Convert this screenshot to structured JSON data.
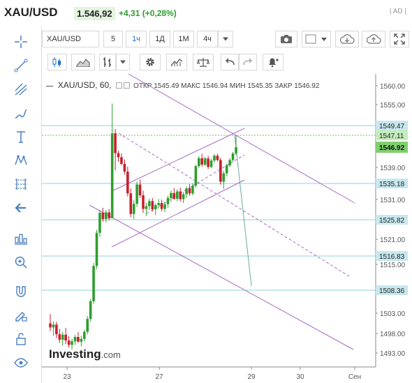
{
  "header": {
    "symbol": "XAU/USD",
    "price": "1.546,92",
    "change": "+4,31 (+0,28%)",
    "ad_label": "| AD |"
  },
  "toolbar": {
    "symbol_field": "XAU/USD",
    "intervals": [
      "5",
      "1ч",
      "1Д",
      "1М",
      "4ч"
    ],
    "active_interval": "1ч"
  },
  "chart_legend": {
    "name": "XAU/USD, 60,",
    "open_label": "ОТКР",
    "open": "1545.49",
    "high_label": "МАКС",
    "high": "1546.94",
    "low_label": "МИН",
    "low": "1545.35",
    "close_label": "ЗАКР",
    "close": "1546.92"
  },
  "logo": {
    "main": "Investing",
    "suffix": ".com"
  },
  "colors": {
    "up": "#2e9e2e",
    "down": "#c8202a",
    "channel": "#a86ac4",
    "hline": "#8fd0dc",
    "hline_label_bg": "#c6e8ee",
    "price_label_bg": "#7fcf6d",
    "accent": "#1c6cd2"
  },
  "chart_data": {
    "type": "candlestick",
    "y_ticks": [
      1560.0,
      1555.0,
      1539.0,
      1531.0,
      1521.0,
      1515.0,
      1503.0,
      1498.0,
      1493.0
    ],
    "y_tick_labels": [
      "1560.00",
      "1555.00",
      "1539.00",
      "1531.00",
      "1521.00",
      "1515.00",
      "1503.00",
      "1498.00",
      "1493.00"
    ],
    "x_ticks": [
      "23",
      "27",
      "29",
      "30",
      "Сен"
    ],
    "hlines": [
      {
        "value": 1549.47,
        "label": "1549.47"
      },
      {
        "value": 1547.11,
        "label": "1547.11"
      },
      {
        "value": 1535.18,
        "label": "1535.18"
      },
      {
        "value": 1525.82,
        "label": "1525.82"
      },
      {
        "value": 1516.83,
        "label": "1516.83"
      },
      {
        "value": 1508.36,
        "label": "1508.36"
      }
    ],
    "current_price": {
      "value": 1546.92,
      "label": "1546.92"
    },
    "ylim": [
      1491,
      1562
    ],
    "candles": [
      [
        1500.5,
        1502.8,
        1498.6,
        1499.5
      ],
      [
        1499.5,
        1501.0,
        1497.4,
        1500.2
      ],
      [
        1500.2,
        1500.9,
        1496.8,
        1497.8
      ],
      [
        1497.8,
        1499.1,
        1495.6,
        1496.4
      ],
      [
        1496.4,
        1498.4,
        1494.9,
        1497.7
      ],
      [
        1497.7,
        1499.4,
        1495.3,
        1496.2
      ],
      [
        1496.2,
        1497.3,
        1494.4,
        1495.1
      ],
      [
        1495.1,
        1496.6,
        1493.9,
        1496.0
      ],
      [
        1496.0,
        1497.6,
        1495.1,
        1497.1
      ],
      [
        1497.1,
        1498.3,
        1495.6,
        1495.9
      ],
      [
        1495.9,
        1497.4,
        1494.7,
        1496.6
      ],
      [
        1496.6,
        1498.9,
        1496.0,
        1498.4
      ],
      [
        1498.4,
        1502.3,
        1497.8,
        1501.6
      ],
      [
        1501.6,
        1506.3,
        1501.0,
        1505.8
      ],
      [
        1505.8,
        1515.3,
        1505.2,
        1514.6
      ],
      [
        1514.6,
        1523.3,
        1513.8,
        1522.6
      ],
      [
        1522.6,
        1528.3,
        1521.6,
        1527.6
      ],
      [
        1527.6,
        1528.9,
        1525.3,
        1526.0
      ],
      [
        1526.0,
        1528.3,
        1525.2,
        1527.7
      ],
      [
        1527.7,
        1528.6,
        1525.6,
        1526.2
      ],
      [
        1526.2,
        1555.3,
        1544.0,
        1547.6
      ],
      [
        1547.6,
        1548.6,
        1538.3,
        1544.6
      ],
      [
        1544.6,
        1545.6,
        1541.2,
        1543.0
      ],
      [
        1543.0,
        1544.5,
        1539.8,
        1540.4
      ],
      [
        1540.4,
        1542.1,
        1537.3,
        1538.0
      ],
      [
        1538.0,
        1539.3,
        1531.8,
        1532.6
      ],
      [
        1532.6,
        1533.9,
        1526.5,
        1527.3
      ],
      [
        1527.3,
        1530.8,
        1526.0,
        1529.9
      ],
      [
        1529.9,
        1535.6,
        1529.1,
        1534.9
      ],
      [
        1534.9,
        1536.1,
        1531.4,
        1532.1
      ],
      [
        1532.1,
        1533.3,
        1527.6,
        1528.6
      ],
      [
        1528.6,
        1530.1,
        1526.8,
        1529.3
      ],
      [
        1529.3,
        1531.2,
        1528.3,
        1530.6
      ],
      [
        1530.6,
        1531.4,
        1527.9,
        1528.5
      ],
      [
        1528.5,
        1530.0,
        1527.0,
        1529.6
      ],
      [
        1529.6,
        1531.1,
        1528.7,
        1530.1
      ],
      [
        1530.1,
        1531.0,
        1528.0,
        1528.6
      ],
      [
        1528.6,
        1530.4,
        1527.8,
        1529.8
      ],
      [
        1529.8,
        1532.0,
        1528.9,
        1531.4
      ],
      [
        1531.4,
        1533.3,
        1530.4,
        1532.7
      ],
      [
        1532.7,
        1534.0,
        1530.9,
        1531.2
      ],
      [
        1531.2,
        1533.7,
        1530.6,
        1533.1
      ],
      [
        1533.1,
        1534.1,
        1530.5,
        1531.1
      ],
      [
        1531.1,
        1532.9,
        1530.1,
        1532.4
      ],
      [
        1532.4,
        1534.4,
        1531.4,
        1533.9
      ],
      [
        1533.9,
        1535.0,
        1532.0,
        1532.6
      ],
      [
        1532.6,
        1535.2,
        1532.1,
        1534.6
      ],
      [
        1534.6,
        1540.1,
        1534.1,
        1539.5
      ],
      [
        1539.5,
        1543.4,
        1538.9,
        1542.6
      ],
      [
        1542.6,
        1544.4,
        1539.3,
        1540.1
      ],
      [
        1540.1,
        1543.1,
        1539.6,
        1542.5
      ],
      [
        1542.5,
        1543.6,
        1538.6,
        1539.2
      ],
      [
        1539.2,
        1542.4,
        1538.8,
        1541.7
      ],
      [
        1541.7,
        1544.3,
        1540.9,
        1543.6
      ],
      [
        1543.6,
        1544.4,
        1541.3,
        1541.9
      ],
      [
        1541.9,
        1542.8,
        1534.9,
        1535.6
      ],
      [
        1535.6,
        1538.2,
        1533.8,
        1537.6
      ],
      [
        1537.6,
        1540.4,
        1536.9,
        1539.8
      ],
      [
        1539.8,
        1542.6,
        1539.1,
        1541.9
      ],
      [
        1541.9,
        1545.1,
        1541.3,
        1544.5
      ],
      [
        1544.5,
        1547.2,
        1543.8,
        1546.9
      ]
    ]
  }
}
